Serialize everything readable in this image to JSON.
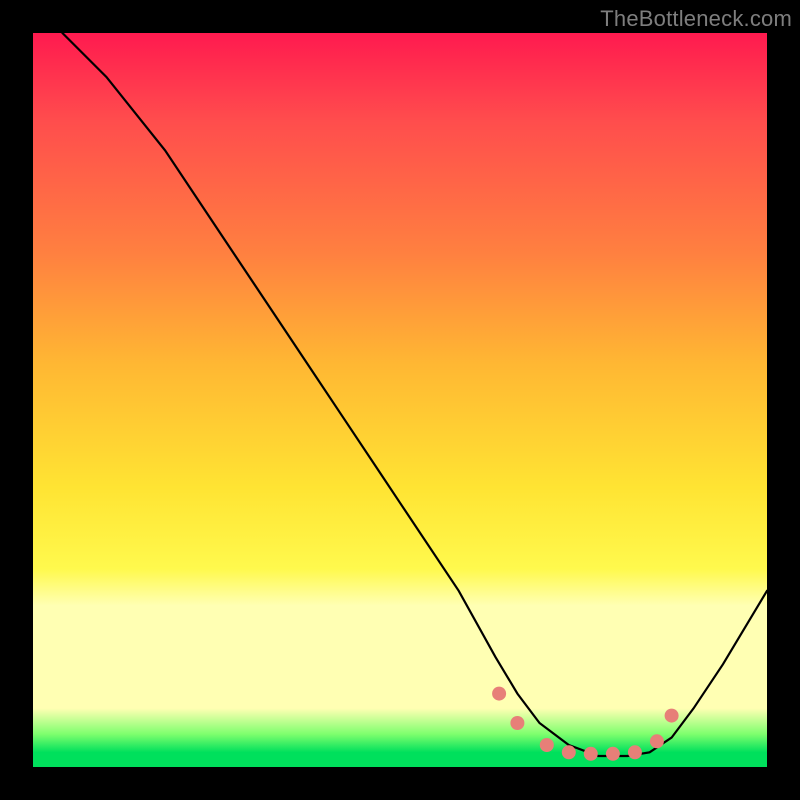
{
  "watermark": "TheBottleneck.com",
  "chart_data": {
    "type": "line",
    "title": "",
    "xlabel": "",
    "ylabel": "",
    "xlim": [
      0,
      100
    ],
    "ylim": [
      0,
      100
    ],
    "series": [
      {
        "name": "curve",
        "x": [
          4,
          10,
          18,
          26,
          34,
          42,
          50,
          58,
          63,
          66,
          69,
          73,
          77,
          81,
          84,
          87,
          90,
          94,
          100
        ],
        "values": [
          100,
          94,
          84,
          72,
          60,
          48,
          36,
          24,
          15,
          10,
          6,
          3,
          1.5,
          1.5,
          2,
          4,
          8,
          14,
          24
        ]
      }
    ],
    "markers": {
      "name": "dots",
      "x": [
        63.5,
        66,
        70,
        73,
        76,
        79,
        82,
        85,
        87
      ],
      "values": [
        10,
        6,
        3,
        2,
        1.8,
        1.8,
        2,
        3.5,
        7
      ]
    },
    "grid": false,
    "legend": false
  }
}
